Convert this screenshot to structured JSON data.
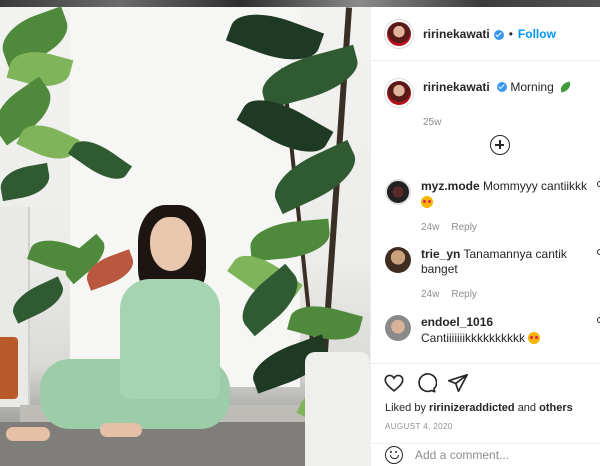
{
  "post": {
    "author": "ririnekawati",
    "follow_label": "Follow",
    "separator": "•",
    "caption_user": "ririnekawati",
    "caption_text": "Morning",
    "caption_time": "25w"
  },
  "comments": [
    {
      "user": "myz.mode",
      "text": "Mommyyy cantiikkk",
      "time": "24w",
      "reply": "Reply"
    },
    {
      "user": "trie_yn",
      "text": "Tanamannya cantik banget",
      "time": "24w",
      "reply": "Reply"
    },
    {
      "user": "endoel_1016",
      "text": "Cantiiiiiiikkkkkkkkkk",
      "time": "",
      "reply": ""
    }
  ],
  "footer": {
    "liked_prefix": "Liked by",
    "liked_user": "ririnizeraddicted",
    "liked_and": "and",
    "liked_others": "others",
    "date": "AUGUST 4, 2020",
    "add_comment_placeholder": "Add a comment..."
  },
  "colors": {
    "accent": "#0095f6",
    "verified": "#3897f0",
    "muted": "#8e8e8e"
  },
  "icons": {
    "like": "heart-icon",
    "comment": "comment-bubble-icon",
    "share": "paper-plane-icon",
    "emoji": "smiley-icon",
    "more": "plus-circle-icon"
  }
}
